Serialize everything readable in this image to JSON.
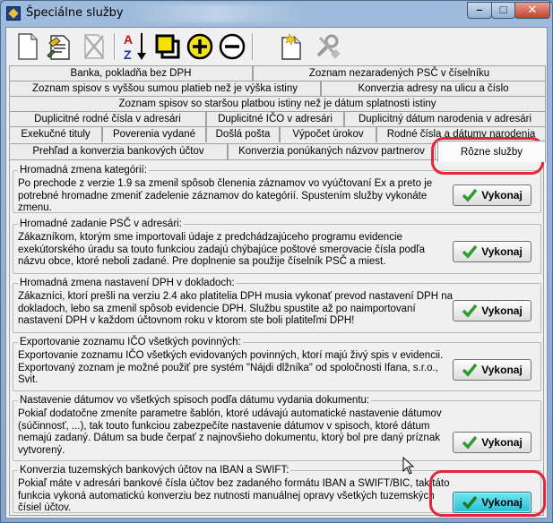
{
  "window": {
    "title": "Špeciálne služby",
    "controls": {
      "minimize": "–",
      "maximize": "□",
      "close": "✕"
    }
  },
  "toolbar": {
    "buttons": [
      {
        "icon": "new-document-icon"
      },
      {
        "icon": "edit-document-icon"
      },
      {
        "icon": "delete-document-icon"
      },
      {
        "icon": "sort-az-icon"
      },
      {
        "icon": "copy-icon"
      },
      {
        "icon": "add-icon"
      },
      {
        "icon": "remove-icon"
      },
      {
        "icon": "new-record-icon"
      },
      {
        "icon": "tools-icon"
      }
    ]
  },
  "tabs": {
    "row1": [
      "Banka, pokladňa bez DPH",
      "Zoznam nezaradených PSČ v číselníku"
    ],
    "row2": [
      "Zoznam spisov s vyššou sumou platieb než je výška istiny",
      "Konverzia adresy na ulicu a číslo"
    ],
    "row3": [
      "Zoznam spisov so staršou platbou istiny než je dátum splatnosti istiny"
    ],
    "row4": [
      "Duplicitné rodné čísla v adresári",
      "Duplicitné IČO v adresári",
      "Duplicitný dátum narodenia v adresári"
    ],
    "row5": [
      "Exekučné tituly",
      "Poverenia vydané",
      "Došlá pošta",
      "Výpočet úrokov",
      "Rodné čísla a dátumy narodenia"
    ],
    "row6": [
      "Prehľad a konverzia bankových účtov",
      "Konverzia ponúkaných názvov partnerov",
      "Rôzne služby"
    ],
    "active": "Rôzne služby"
  },
  "groups": [
    {
      "title": "Hromadná zmena kategórií:",
      "description": "Po prechode z verzie 1.9 sa zmenil spôsob členenia záznamov vo vyúčtovaní Ex a preto je potrebné hromadne zmeniť zadelenie záznamov do kategórií. Spustením služby vykonáte zmenu.",
      "button": "Vykonaj"
    },
    {
      "title": "Hromadné zadanie PSČ v adresári:",
      "description": "Zákazníkom, ktorým sme importovali údaje z predchádzajúceho programu evidencie exekútorského úradu sa touto funkciou zadajú chýbajúce poštové smerovacie čísla podľa názvu obce, ktoré neboli zadané. Pre doplnenie sa použije číselník PSČ a miest.",
      "button": "Vykonaj"
    },
    {
      "title": "Hromadná zmena nastavení DPH v dokladoch:",
      "description": "Zákazníci, ktorí prešli na verziu 2.4 ako platitelia DPH musia vykonať prevod nastavení DPH na dokladoch, lebo sa zmenil spôsob evidencie DPH. Službu spustite až po naimportovaní nastavení DPH v každom účtovnom roku v ktorom ste boli platiteľmi DPH!",
      "button": "Vykonaj"
    },
    {
      "title": "Exportovanie zoznamu IČO všetkých povinných:",
      "description": "Exportovanie zoznamu IČO všetkých evidovaných povinných, ktorí majú živý spis v evidencii. Exportovaný zoznam je možné použiť pre systém \"Nájdi dlžníka\" od spoločnosti Ifana, s.r.o., Svit.",
      "button": "Vykonaj"
    },
    {
      "title": "Nastavenie dátumov vo všetkých spisoch podľa dátumu vydania dokumentu:",
      "description": "Pokiaľ dodatočne zmeníte parametre šablón, ktoré udávajú automatické nastavenie dátumov (súčinnosť, ...), tak touto funkciou zabezpečíte nastavenie dátumov v spisoch, ktoré dátum nemajú zadaný. Dátum sa bude čerpať z najnovšieho dokumentu, ktorý bol pre daný príznak vytvorený.",
      "button": "Vykonaj"
    },
    {
      "title": "Konverzia tuzemských bankových účtov na IBAN a SWIFT:",
      "description": "Pokiaľ máte v adresári bankové čísla účtov bez zadaného formátu IBAN a SWIFT/BIC, tak táto funkcia vykoná automatickú konverziu bez nutnosti manuálnej opravy všetkých tuzemských čísiel účtov.",
      "button": "Vykonaj"
    }
  ],
  "colors": {
    "highlight": "#e0263b",
    "focused_button": "#28bfd6",
    "check": "#2e9b2e"
  }
}
